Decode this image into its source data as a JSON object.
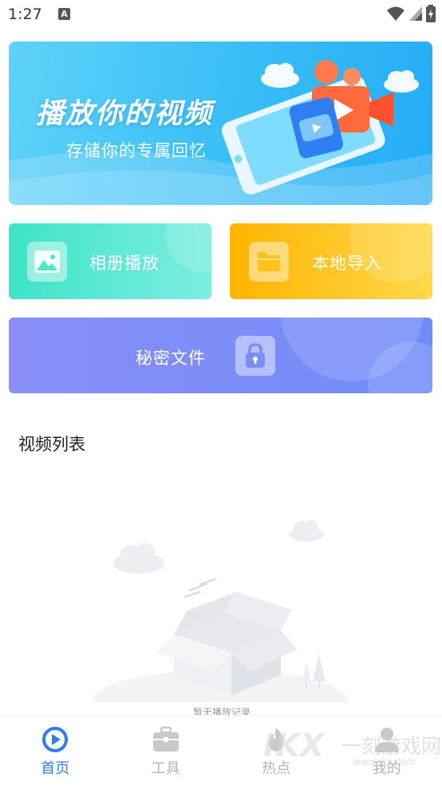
{
  "status_bar": {
    "time": "1:27",
    "notification_icon": "A"
  },
  "banner": {
    "title": "播放你的视频",
    "subtitle": "存储你的专属回忆"
  },
  "cards": {
    "album_label": "相册播放",
    "import_label": "本地导入",
    "secret_label": "秘密文件"
  },
  "video_list": {
    "title": "视频列表",
    "empty_text": "暂无播放记录"
  },
  "tabs": [
    {
      "label": "首页",
      "icon": "play-circle-icon",
      "active": true
    },
    {
      "label": "工具",
      "icon": "toolbox-icon",
      "active": false
    },
    {
      "label": "热点",
      "icon": "flame-icon",
      "active": false
    },
    {
      "label": "我的",
      "icon": "user-icon",
      "active": false
    }
  ],
  "watermark": {
    "logo": "IKX",
    "text": "一刻游戏网",
    "url": "www.ikx.com"
  },
  "colors": {
    "accent": "#2e7cf0",
    "album_card": "#3fe3c6",
    "import_card": "#ffb400",
    "secret_card": "#7d8df7",
    "banner": "#3ec0f7"
  }
}
